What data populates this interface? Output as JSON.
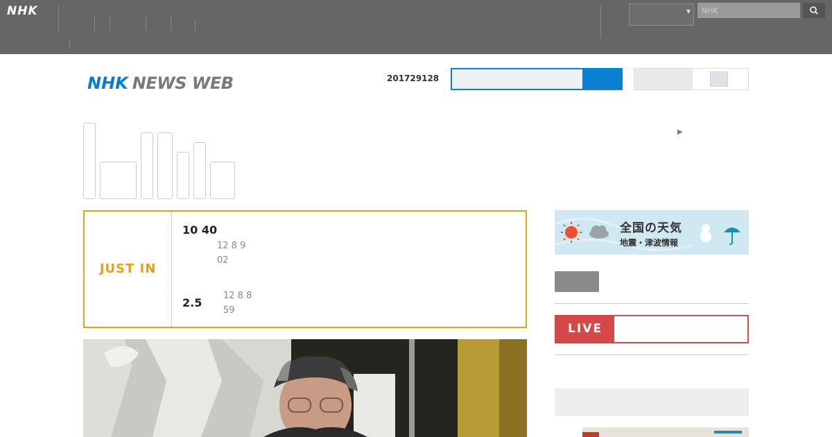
{
  "global_nav": {
    "logo": "NHK",
    "items": [
      {
        "l1": "",
        "l2": ""
      },
      {
        "l1": "",
        "l2": ""
      },
      {
        "l1": "",
        "l2": ""
      },
      {
        "l1": "",
        "l2": ""
      },
      {
        "l1": "",
        "l2": ""
      },
      {
        "l1": "",
        "l2": ""
      },
      {
        "l1": "",
        "l2": ""
      }
    ],
    "right_items": [
      {
        "l1": "",
        "l2": ""
      },
      {
        "l1": "",
        "l2": ""
      }
    ],
    "region_value": "",
    "search_placeholder": "NHK"
  },
  "header": {
    "logo_nhk": "NHK",
    "logo_newsweb": "NEWS WEB",
    "date": "201729128",
    "search_placeholder": "",
    "text_size_label": ""
  },
  "categories": [
    {
      "label": ""
    },
    {
      "label": ""
    },
    {
      "label": ""
    },
    {
      "label": ""
    },
    {
      "label": ""
    },
    {
      "label": ""
    },
    {
      "label": ""
    }
  ],
  "top_link": "",
  "just_in": {
    "label": "JUST IN",
    "items": [
      {
        "title_line1": "10 40",
        "title_line2": "",
        "time_line1": "12 8 9",
        "time_line2": "02"
      },
      {
        "title_line1": "",
        "title_line2": "2.5",
        "time_line1": "12 8 8",
        "time_line2": "59"
      }
    ]
  },
  "weather": {
    "title": "全国の天気",
    "subtitle": "地震・津波情報"
  },
  "side_link": "",
  "live": {
    "label": "LIVE",
    "text": ""
  },
  "side_heading": "",
  "colors": {
    "accent_blue": "#0b7fd1",
    "justin_orange": "#e8a019",
    "live_red": "#d44848",
    "topbar": "#666666"
  }
}
